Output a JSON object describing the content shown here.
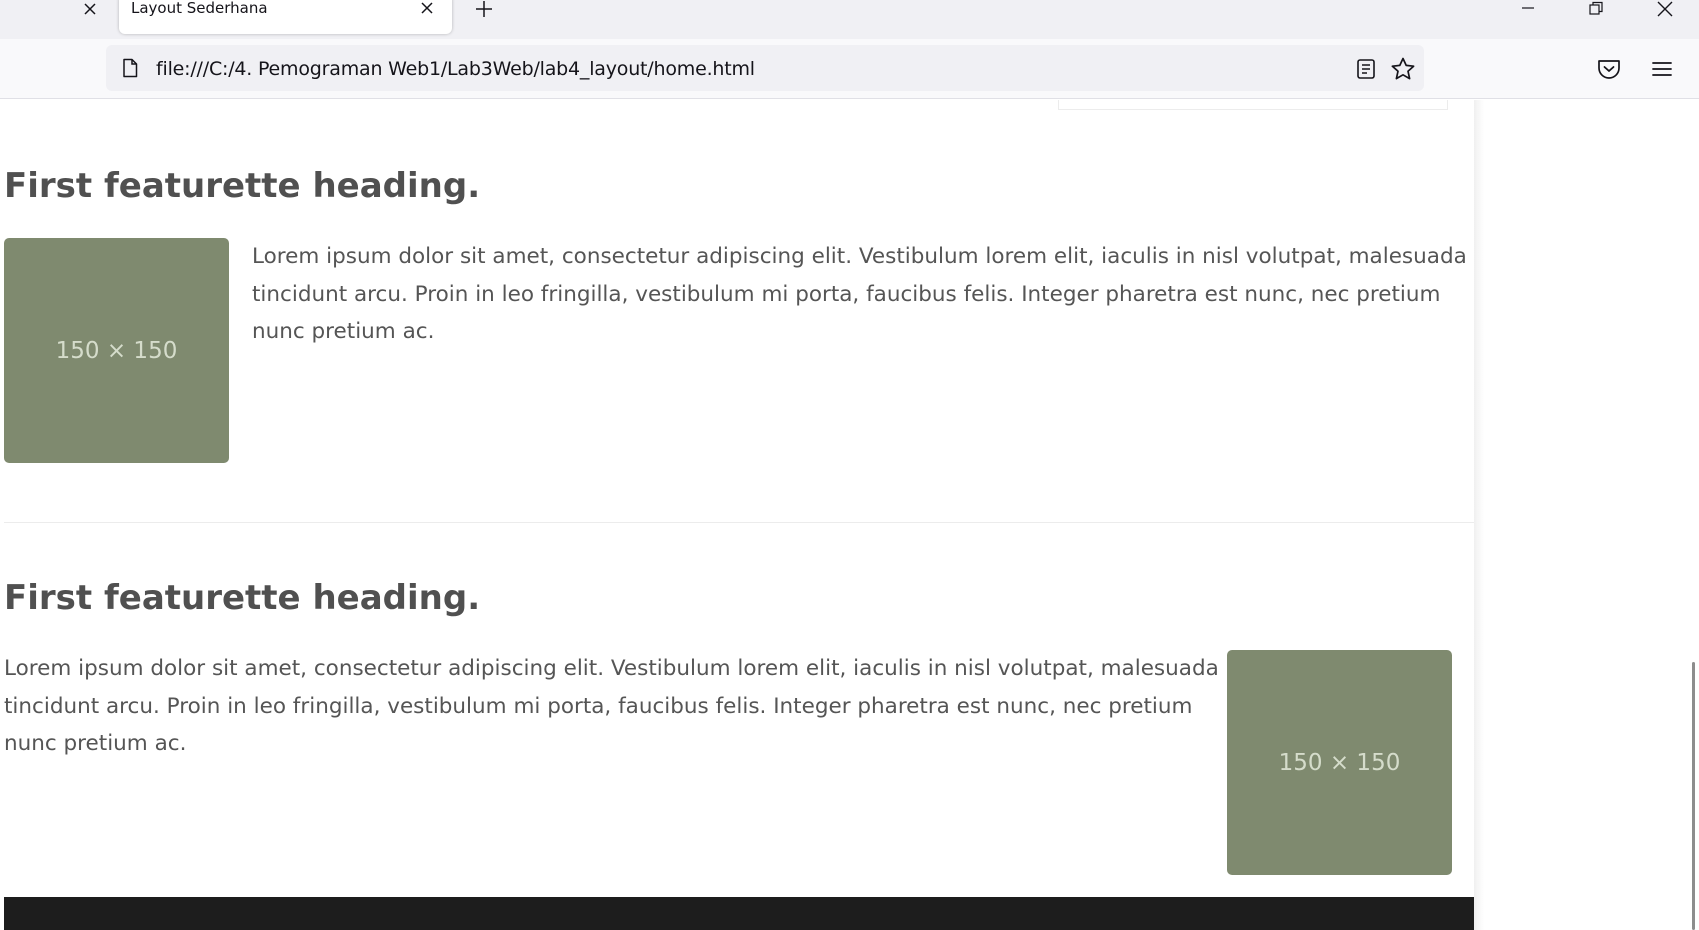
{
  "browser": {
    "tab": {
      "title": "Layout Sederhana"
    },
    "url": "file:///C:/4. Pemograman Web1/Lab3Web/lab4_layout/home.html"
  },
  "page": {
    "featurettes": [
      {
        "heading": "First featurette heading.",
        "text": "Lorem ipsum dolor sit amet, consectetur adipiscing elit. Vestibulum lorem elit, iaculis in nisl volutpat, malesuada tincidunt arcu. Proin in leo fringilla, vestibulum mi porta, faucibus felis. Integer pharetra est nunc, nec pretium nunc pretium ac.",
        "image_label": "150 × 150"
      },
      {
        "heading": "First featurette heading.",
        "text": "Lorem ipsum dolor sit amet, consectetur adipiscing elit. Vestibulum lorem elit, iaculis in nisl volutpat, malesuada tincidunt arcu. Proin in leo fringilla, vestibulum mi porta, faucibus felis. Integer pharetra est nunc, nec pretium nunc pretium ac.",
        "image_label": "150 × 150"
      }
    ]
  },
  "icons": {
    "tab_close": "close-icon",
    "new_tab": "plus-icon",
    "minimize": "minimize-icon",
    "restore": "restore-icon",
    "close_window": "close-icon",
    "page": "page-icon",
    "reader": "reader-view-icon",
    "bookmark": "star-icon",
    "pocket": "pocket-icon",
    "menu": "hamburger-menu-icon"
  },
  "colors": {
    "placeholder_bg": "#7f8a6f",
    "placeholder_text": "#d5dccb",
    "heading": "#505050",
    "body_text": "#555555",
    "footer": "#1d1d1d"
  }
}
